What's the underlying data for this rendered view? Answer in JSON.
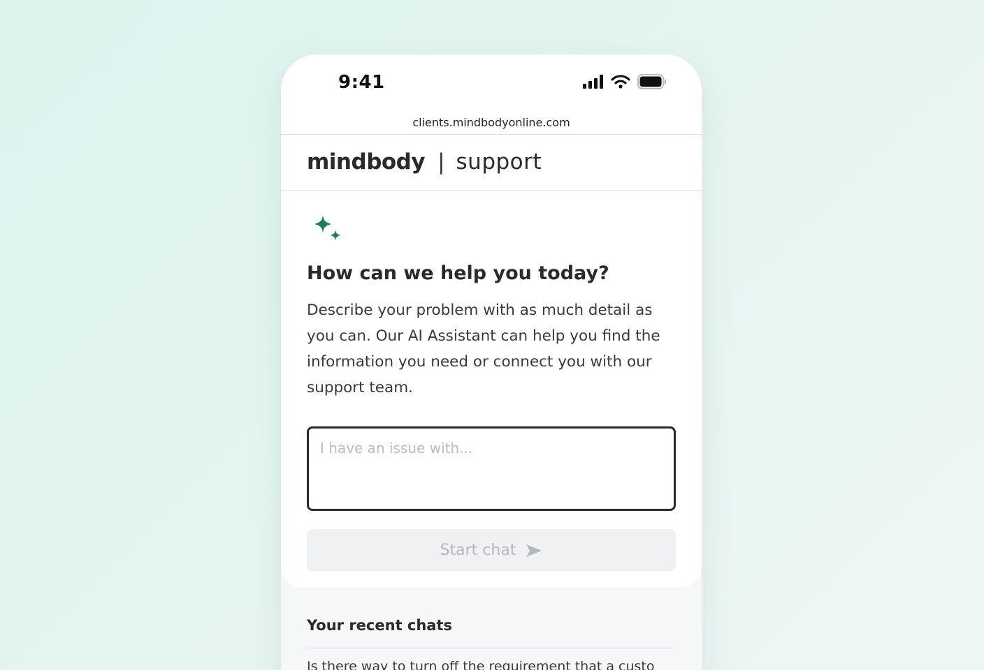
{
  "status_bar": {
    "time": "9:41",
    "icons": [
      "cellular-signal-icon",
      "wifi-icon",
      "battery-icon"
    ]
  },
  "browser": {
    "url": "clients.mindbodyonline.com"
  },
  "header": {
    "brand_name": "mindbody",
    "separator": "|",
    "section": "support"
  },
  "main": {
    "icon": "sparkle-icon",
    "heading": "How can we help you today?",
    "description": "Describe your problem with as much detail as you can. Our AI Assistant can help you find the information you need or connect you with our support team.",
    "input_placeholder": "I have an issue with...",
    "input_value": "",
    "start_button_label": "Start chat",
    "start_button_icon": "send-arrow-icon"
  },
  "recent_chats": {
    "title": "Your recent chats",
    "items": [
      "Is there way to turn off the requirement that a custo"
    ]
  },
  "colors": {
    "background": "#dcf3ee",
    "accent_green": "#1a7f5e",
    "text_dark": "#2b2b2b",
    "button_disabled_bg": "#f0f1f3",
    "button_disabled_text": "#b4b8bf"
  }
}
